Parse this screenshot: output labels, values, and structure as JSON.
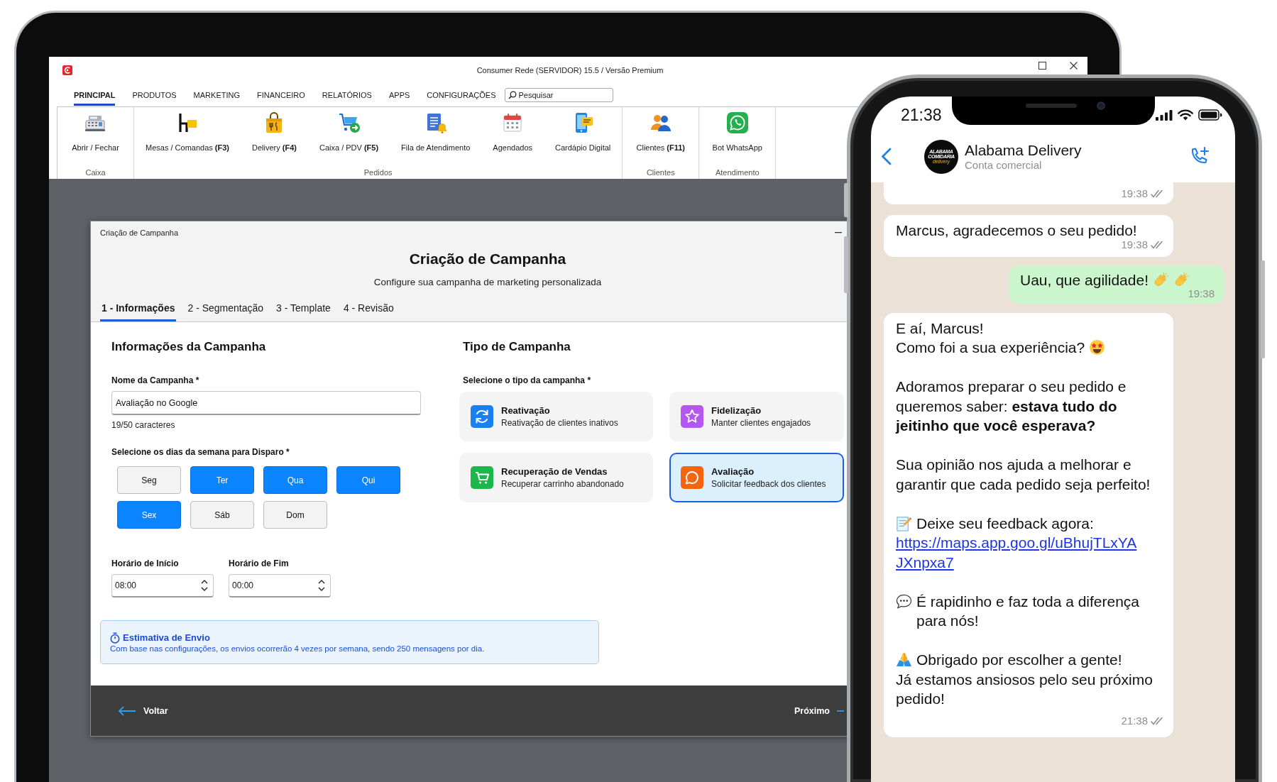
{
  "laptop": {
    "window": {
      "title": "Consumer Rede (SERVIDOR) 15.5 / Versão Premium"
    },
    "menu_tabs": [
      {
        "label": "PRINCIPAL",
        "selected": true
      },
      {
        "label": "PRODUTOS",
        "selected": false
      },
      {
        "label": "MARKETING",
        "selected": false
      },
      {
        "label": "FINANCEIRO",
        "selected": false
      },
      {
        "label": "RELATÓRIOS",
        "selected": false
      },
      {
        "label": "APPS",
        "selected": false
      },
      {
        "label": "CONFIGURAÇÕES",
        "selected": false
      }
    ],
    "search": {
      "placeholder": "Pesquisar"
    },
    "ribbon": [
      {
        "label": "Caixa",
        "items": [
          {
            "kind": "cashier",
            "label": "Abrir / Fechar"
          }
        ]
      },
      {
        "label": "Pedidos",
        "items": [
          {
            "kind": "tables",
            "label": "Mesas / Comandas **(F3)**"
          },
          {
            "kind": "delivery",
            "label": "Delivery **(F4)**"
          },
          {
            "kind": "pos",
            "label": "Caixa / PDV **(F5)**"
          },
          {
            "kind": "queue",
            "label": "Fila de Atendimento"
          },
          {
            "kind": "schedule",
            "label": "Agendados"
          },
          {
            "kind": "menu",
            "label": "Cardápio Digital"
          }
        ]
      },
      {
        "label": "Clientes",
        "items": [
          {
            "kind": "clients",
            "label": "Clientes **(F11)**"
          }
        ]
      },
      {
        "label": "Atendimento",
        "items": [
          {
            "kind": "bot",
            "label": "Bot WhatsApp"
          }
        ]
      }
    ],
    "dialog": {
      "title": "Criação de Campanha",
      "heading": "Criação de Campanha",
      "subtitle": "Configure sua campanha de marketing personalizada",
      "steps": [
        {
          "label": "1 - Informações",
          "selected": true
        },
        {
          "label": "2 - Segmentação",
          "selected": false
        },
        {
          "label": "3 - Template",
          "selected": false
        },
        {
          "label": "4 - Revisão",
          "selected": false
        }
      ],
      "info": {
        "heading": "Informações da Campanha",
        "name_label": "Nome da Campanha *",
        "name_value": "Avaliação no Google",
        "counter": "19/50 caracteres",
        "days_label": "Selecione os dias da semana para Disparo *",
        "days": [
          {
            "label": "Seg",
            "selected": false
          },
          {
            "label": "Ter",
            "selected": true
          },
          {
            "label": "Qua",
            "selected": true
          },
          {
            "label": "Qui",
            "selected": true
          },
          {
            "label": "Sex",
            "selected": true
          },
          {
            "label": "Sáb",
            "selected": false
          },
          {
            "label": "Dom",
            "selected": false
          }
        ],
        "start_label": "Horário de Início",
        "start_value": "08:00",
        "end_label": "Horário de Fim",
        "end_value": "00:00"
      },
      "type": {
        "heading": "Tipo de Campanha",
        "label": "Selecione o tipo da campanha *",
        "options": [
          {
            "kind": "reactivation",
            "title": "Reativação",
            "description": "Reativação de clientes inativos",
            "color": "#1a7ff0",
            "selected": false
          },
          {
            "kind": "loyalty",
            "title": "Fidelização",
            "description": "Manter clientes engajados",
            "color": "#b457f0",
            "selected": false
          },
          {
            "kind": "recovery",
            "title": "Recuperação de Vendas",
            "description": "Recuperar carrinho abandonado",
            "color": "#1cb64a",
            "selected": false
          },
          {
            "kind": "review",
            "title": "Avaliação",
            "description": "Solicitar feedback dos clientes",
            "color": "#f5650f",
            "selected": true
          }
        ]
      },
      "estimate": {
        "title": "Estimativa de Envio",
        "text": "Com base nas configurações, os envios ocorrerão 4 vezes por semana, sendo 250 mensagens por dia."
      },
      "footer": {
        "back": "Voltar",
        "next": "Próximo"
      }
    }
  },
  "phone": {
    "status_time": "21:38",
    "chat": {
      "name": "Alabama Delivery",
      "subtitle": "Conta comercial",
      "avatar": {
        "logo_lines": [
          "ALABAMA",
          "COMIDARIA"
        ],
        "logo_tagline": "delivery"
      },
      "messages": [
        {
          "outgoing": false,
          "clipped": true,
          "time": "19:38",
          "delivered": true
        },
        {
          "outgoing": false,
          "clipped": false,
          "paragraphs": [
            {
              "kind": "plain",
              "lines": [
                "Marcus, agradecemos o seu pedido!"
              ]
            }
          ],
          "time": "19:38",
          "delivered": true
        },
        {
          "outgoing": true,
          "clipped": false,
          "paragraphs": [
            {
              "kind": "applause",
              "lines": [
                "Uau, que agilidade!"
              ]
            }
          ],
          "time": "19:38",
          "delivered": false
        },
        {
          "outgoing": false,
          "clipped": false,
          "paragraphs": [
            {
              "kind": "question",
              "lines": [
                "E aí, Marcus!",
                "Como foi a sua experiência?"
              ]
            },
            {
              "kind": "plain",
              "lines": [
                "Adoramos preparar o seu pedido e queremos saber: **estava tudo do jeitinho que você esperava?**"
              ]
            },
            {
              "kind": "plain",
              "lines": [
                "Sua opinião nos ajuda a melhorar e garantir que cada pedido seja perfeito!"
              ]
            },
            {
              "kind": "feedback",
              "lines": [
                "Deixe seu feedback agora:"
              ],
              "link": "https://maps.app.goo.gl/uBhujTLxYAJXnpxa7"
            },
            {
              "kind": "remark",
              "lines": [
                "É rapidinho e faz toda a diferença para nós!"
              ]
            },
            {
              "kind": "thanks",
              "lines": [
                "Obrigado por escolher a gente!",
                "Já estamos ansiosos pelo seu próximo pedido!"
              ]
            }
          ],
          "time": "21:38",
          "delivered": true
        }
      ]
    }
  }
}
